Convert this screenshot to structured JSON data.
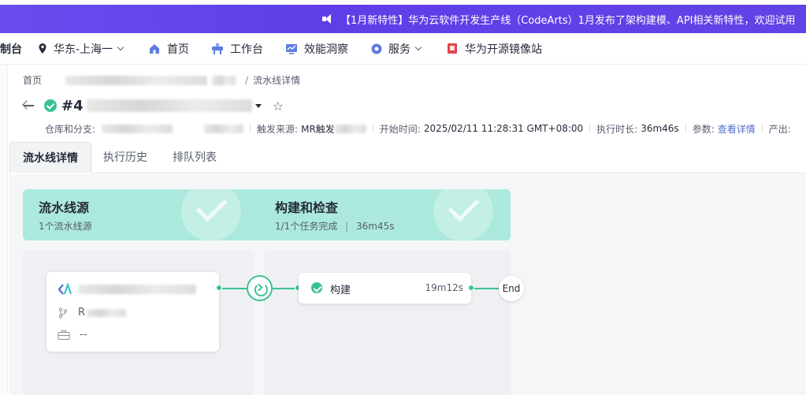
{
  "banner": {
    "text": "【1月新特性】华为云软件开发生产线（CodeArts）1月发布了架构建模、API相关新特性，欢迎试用"
  },
  "nav": {
    "console_label": "制台",
    "region": "华东-上海一",
    "home": "首页",
    "workbench": "工作台",
    "insights": "效能洞察",
    "services": "服务",
    "mirror": "华为开源镜像站"
  },
  "breadcrumb": {
    "home": "首页",
    "sep": "/",
    "current": "流水线详情"
  },
  "header": {
    "title_prefix": "#4"
  },
  "meta": {
    "repo_label": "仓库和分支:",
    "trigger_label": "触发来源:",
    "trigger_value": "MR触发",
    "start_label": "开始时间:",
    "start_value": "2025/02/11 11:28:31 GMT+08:00",
    "duration_label": "执行时长:",
    "duration_value": "36m46s",
    "params_label": "参数:",
    "params_link": "查看详情",
    "output_label": "产出:"
  },
  "tabs": [
    "流水线详情",
    "执行历史",
    "排队列表"
  ],
  "stages": [
    {
      "name": "流水线源",
      "info": "1个流水线源"
    },
    {
      "name": "构建和检查",
      "info": "1/1个任务完成",
      "time": "36m45s"
    }
  ],
  "source_card": {
    "branch_prefix": "R",
    "empty_value": "--"
  },
  "job_card": {
    "name": "构建",
    "duration": "19m12s"
  },
  "end_label": "End",
  "colors": {
    "success": "#3ac295",
    "stage_bg": "#ace9dd",
    "banner": "#6243e6",
    "link": "#526ecc"
  }
}
